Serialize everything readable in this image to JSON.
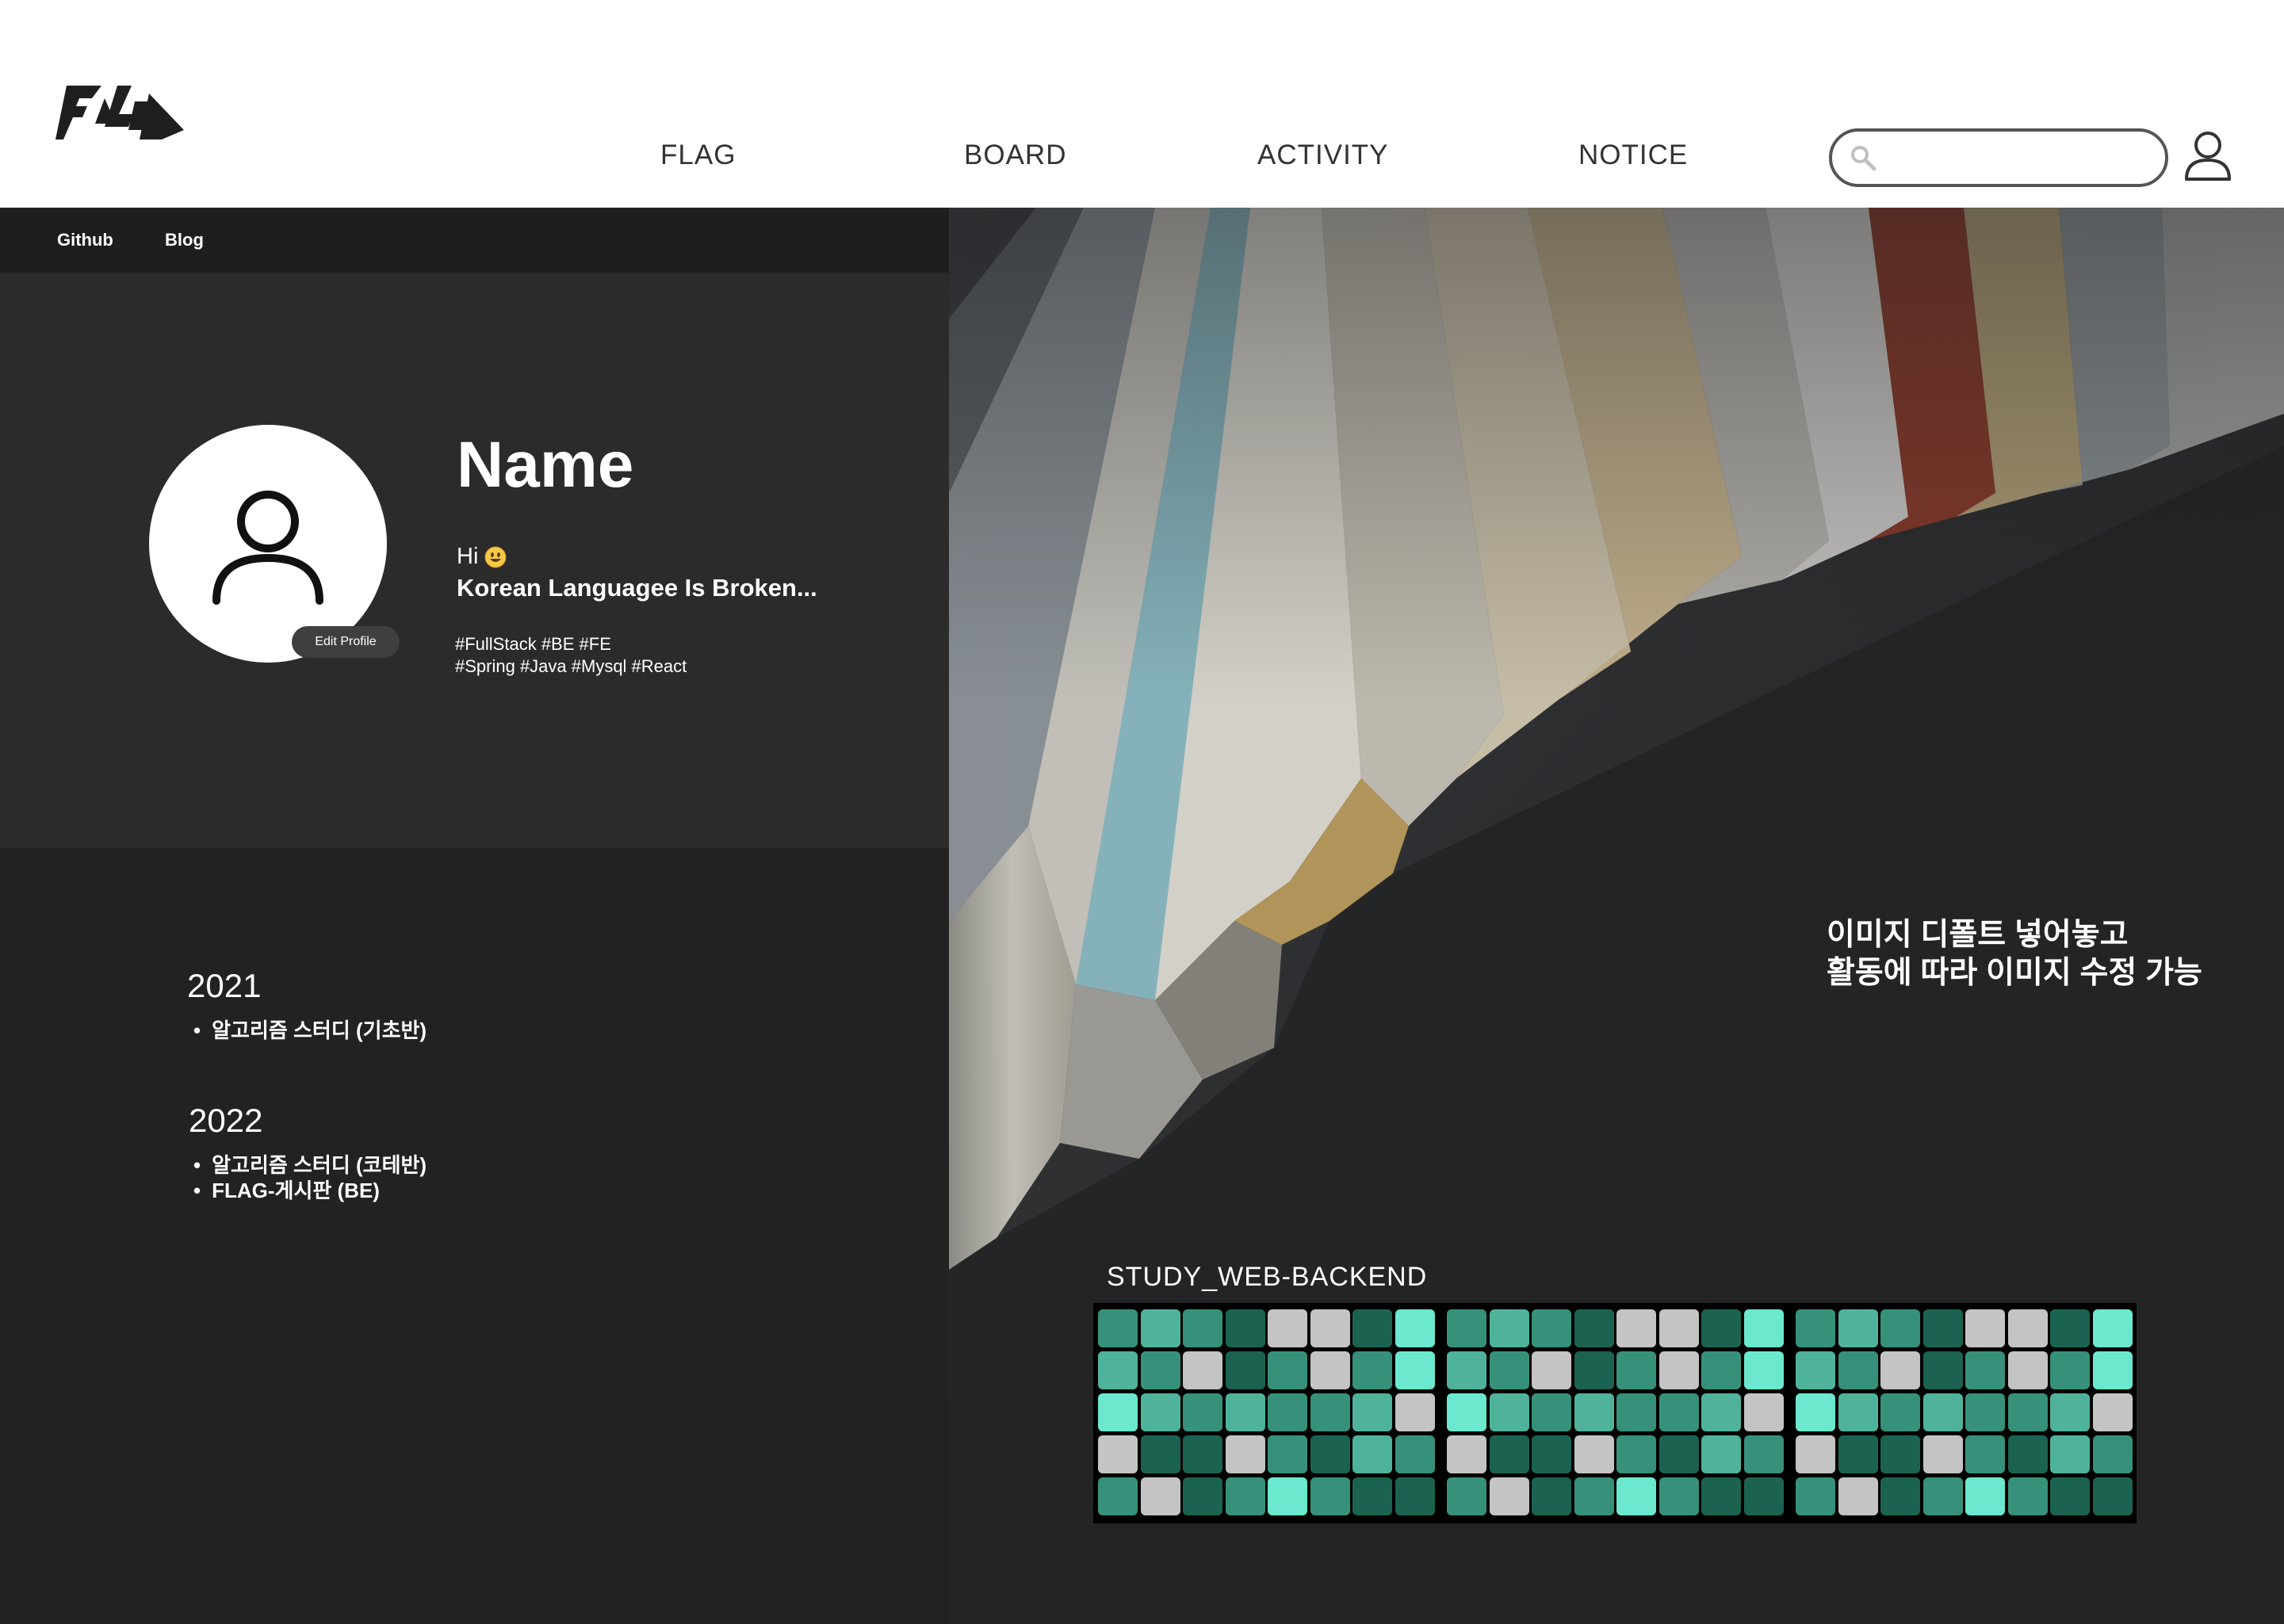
{
  "header": {
    "nav": [
      "FLAG",
      "BOARD",
      "ACTIVITY",
      "NOTICE"
    ],
    "search": {
      "value": "",
      "placeholder": ""
    }
  },
  "subnav": {
    "github": "Github",
    "blog": "Blog"
  },
  "profile": {
    "name": "Name",
    "greeting": "Hi",
    "bio": "Korean Languagee Is Broken...",
    "tags_line1": "#FullStack #BE #FE",
    "tags_line2": "#Spring #Java #Mysql #React",
    "edit_label": "Edit Profile"
  },
  "activities": [
    {
      "year": "2021",
      "items": [
        "알고리즘 스터디 (기초반)"
      ]
    },
    {
      "year": "2022",
      "items": [
        "알고리즘 스터디 (코테반)",
        "FLAG-게시판 (BE)"
      ]
    }
  ],
  "hero": {
    "caption_line1": "이미지 디폴트 넣어놓고",
    "caption_line2": "활동에 따라 이미지 수정 가능"
  },
  "study": {
    "title": "STUDY_WEB-BACKEND",
    "colors": {
      "a": "#37917a",
      "b": "#4fb39c",
      "c": "#1b6350",
      "g": "#c4c4c4",
      "m": "#6be8cd"
    },
    "rows": [
      "abacggcm",
      "bagcagam",
      "mbabaabg",
      "gccgacba",
      "agcamacc"
    ],
    "blocks": 3
  }
}
